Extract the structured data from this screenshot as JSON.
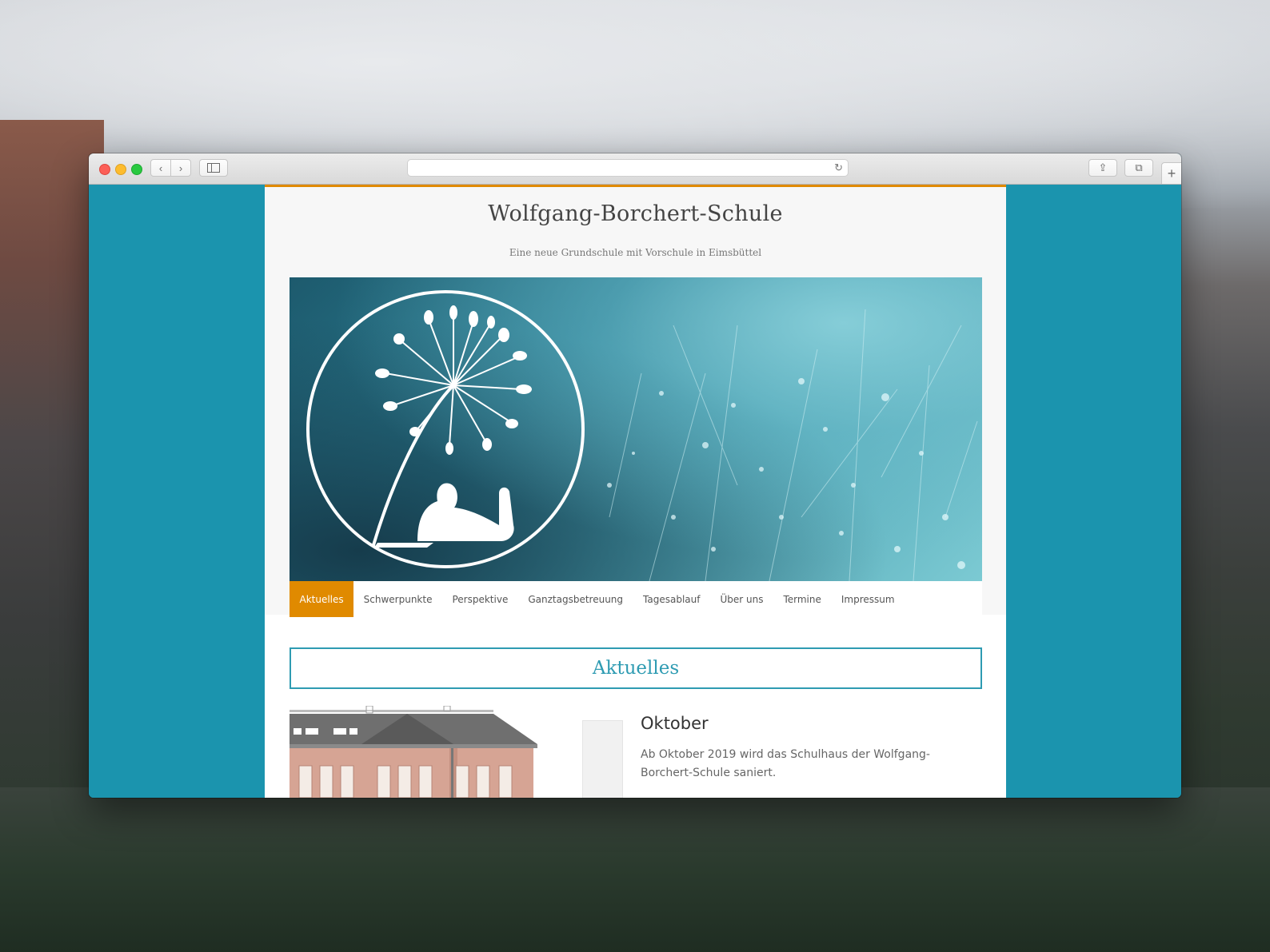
{
  "browser": {
    "address_text": "",
    "icons": {
      "back": "chevron-left-icon",
      "forward": "chevron-right-icon",
      "sidebar": "sidebar-icon",
      "reload": "reload-icon",
      "share": "share-icon",
      "tabs": "tabs-icon",
      "new_tab": "plus-icon"
    },
    "glyphs": {
      "back": "‹",
      "forward": "›",
      "reload": "↻",
      "share": "⇪",
      "tabs": "⧉",
      "new_tab": "+"
    }
  },
  "site": {
    "title": "Wolfgang-Borchert-Schule",
    "tagline": "Eine neue Grundschule mit Vorschule in Eimsbüttel"
  },
  "menu": [
    {
      "label": "Aktuelles",
      "active": true
    },
    {
      "label": "Schwerpunkte",
      "active": false
    },
    {
      "label": "Perspektive",
      "active": false
    },
    {
      "label": "Ganztagsbetreuung",
      "active": false
    },
    {
      "label": "Tagesablauf",
      "active": false
    },
    {
      "label": "Über uns",
      "active": false
    },
    {
      "label": "Termine",
      "active": false
    },
    {
      "label": "Impressum",
      "active": false
    }
  ],
  "section": {
    "title": "Aktuelles"
  },
  "post": {
    "title": "Oktober",
    "text": "Ab Oktober 2019 wird das Schulhaus der Wolfgang-Borchert-Schule saniert."
  },
  "colors": {
    "page_background": "#1b94ae",
    "accent_orange": "#e08a00",
    "accent_teal": "#2e9bb2"
  }
}
